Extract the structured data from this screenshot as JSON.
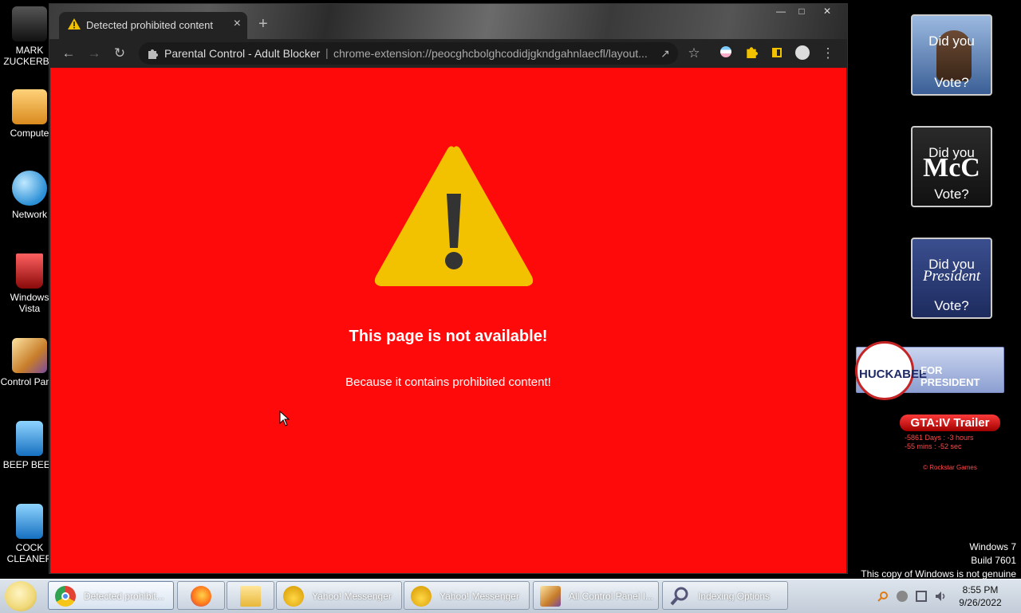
{
  "desktop_icons": [
    {
      "label": "MARK ZUCKERBE",
      "icon": "person-icon",
      "color": "#222"
    },
    {
      "label": "Compute",
      "icon": "computer-icon",
      "color": "#e8a23a"
    },
    {
      "label": "Network",
      "icon": "network-globe-icon",
      "color": "#3aa6e8"
    },
    {
      "label": "Windows Vista",
      "icon": "recycle-bin-icon",
      "color": "#c21a1a"
    },
    {
      "label": "Control Panel",
      "icon": "control-panel-icon",
      "color": "#d48f3b"
    },
    {
      "label": "BEEP BEEF",
      "icon": "blue-folder-icon",
      "color": "#2a8fe0"
    },
    {
      "label": "COCK CLEANER",
      "icon": "blue-folder-icon",
      "color": "#2a8fe0"
    }
  ],
  "browser": {
    "tab_title": "Detected prohibited content",
    "tab_close": "×",
    "new_tab": "+",
    "site_name": "Parental Control - Adult Blocker",
    "url_separator": "|",
    "url": "chrome-extension://peocghcbolghcodidjgkndgahnlaecfl/layout...",
    "window_controls": {
      "minimize": "—",
      "maximize": "□",
      "close": "✕"
    }
  },
  "page": {
    "headline": "This page is not available!",
    "subline": "Because it contains prohibited content!",
    "background": "#ff0a0a",
    "warning_color": "#f2c200"
  },
  "gadgets": [
    {
      "top": "Did you",
      "middle": "",
      "bottom": "Vote?",
      "style": "photo"
    },
    {
      "top": "Did you",
      "middle": "McC",
      "bottom": "Vote?",
      "style": "dark"
    },
    {
      "top": "Did you",
      "middle": "President",
      "bottom": "Vote?",
      "style": "navy"
    }
  ],
  "huckabee": {
    "name": "HUCKABEE",
    "tagline": "FOR PRESIDENT"
  },
  "gta": {
    "button": "GTA:IV Trailer",
    "countdown_line1": "-5861 Days : -3 hours",
    "countdown_line2": "-55 mins : -52 sec",
    "credit": "© Rockstar Games"
  },
  "windows_notice": {
    "line1": "Windows 7",
    "line2": "Build 7601",
    "line3": "This copy of Windows is not genuine"
  },
  "taskbar": {
    "items": [
      {
        "label": "Detected prohibit...",
        "icon": "chrome-icon",
        "active": true
      },
      {
        "label": "",
        "icon": "firefox-icon",
        "active": false
      },
      {
        "label": "",
        "icon": "folder-icon",
        "active": false
      },
      {
        "label": "Yahoo! Messenger",
        "icon": "yahoo-messenger-icon",
        "active": false
      },
      {
        "label": "Yahoo! Messenger",
        "icon": "yahoo-messenger-icon",
        "active": false
      },
      {
        "label": "All Control Panel I...",
        "icon": "control-panel-icon",
        "active": false
      },
      {
        "label": "Indexing Options",
        "icon": "indexing-icon",
        "active": false
      }
    ],
    "clock_time": "8:55 PM",
    "clock_date": "9/26/2022"
  }
}
